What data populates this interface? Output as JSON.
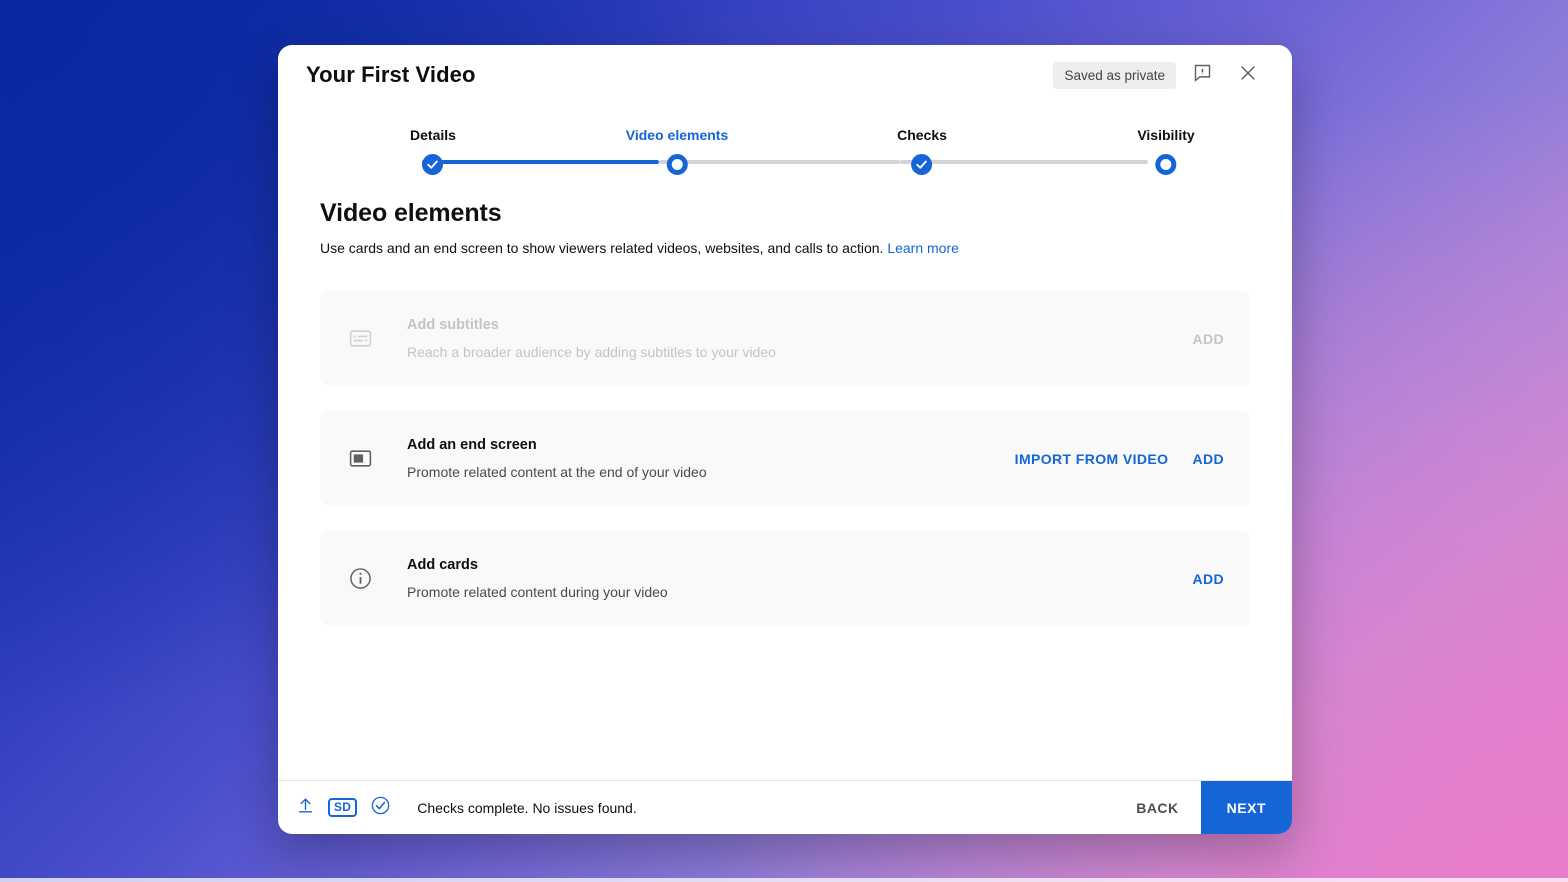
{
  "window": {
    "title": "Your First Video",
    "status_chip": "Saved as private",
    "feedback_icon": "feedback-bubble-icon",
    "close_icon": "close-icon"
  },
  "stepper": {
    "steps": [
      {
        "label": "Details",
        "state": "complete"
      },
      {
        "label": "Video elements",
        "state": "current"
      },
      {
        "label": "Checks",
        "state": "complete"
      },
      {
        "label": "Visibility",
        "state": "upcoming"
      }
    ]
  },
  "main": {
    "heading": "Video elements",
    "description": "Use cards and an end screen to show viewers related videos, websites, and calls to action.",
    "learn_more": "Learn more",
    "cards": [
      {
        "icon": "subtitles-icon",
        "title": "Add subtitles",
        "description": "Reach a broader audience by adding subtitles to your video",
        "primary_action": "ADD",
        "secondary_action": "",
        "disabled": true
      },
      {
        "icon": "end-screen-icon",
        "title": "Add an end screen",
        "description": "Promote related content at the end of your video",
        "primary_action": "ADD",
        "secondary_action": "IMPORT FROM VIDEO",
        "disabled": false
      },
      {
        "icon": "info-circle-icon",
        "title": "Add cards",
        "description": "Promote related content during your video",
        "primary_action": "ADD",
        "secondary_action": "",
        "disabled": false
      }
    ]
  },
  "footer": {
    "upload_icon": "upload-arrow-icon",
    "quality_badge": "SD",
    "checks_icon": "check-circle-icon",
    "status": "Checks complete. No issues found.",
    "back_label": "BACK",
    "next_label": "NEXT"
  },
  "colors": {
    "accent_blue": "#1565d8",
    "track_grey": "#d3d3d3",
    "card_bg": "#f9f9f9",
    "chip_bg": "#eeeeee"
  }
}
